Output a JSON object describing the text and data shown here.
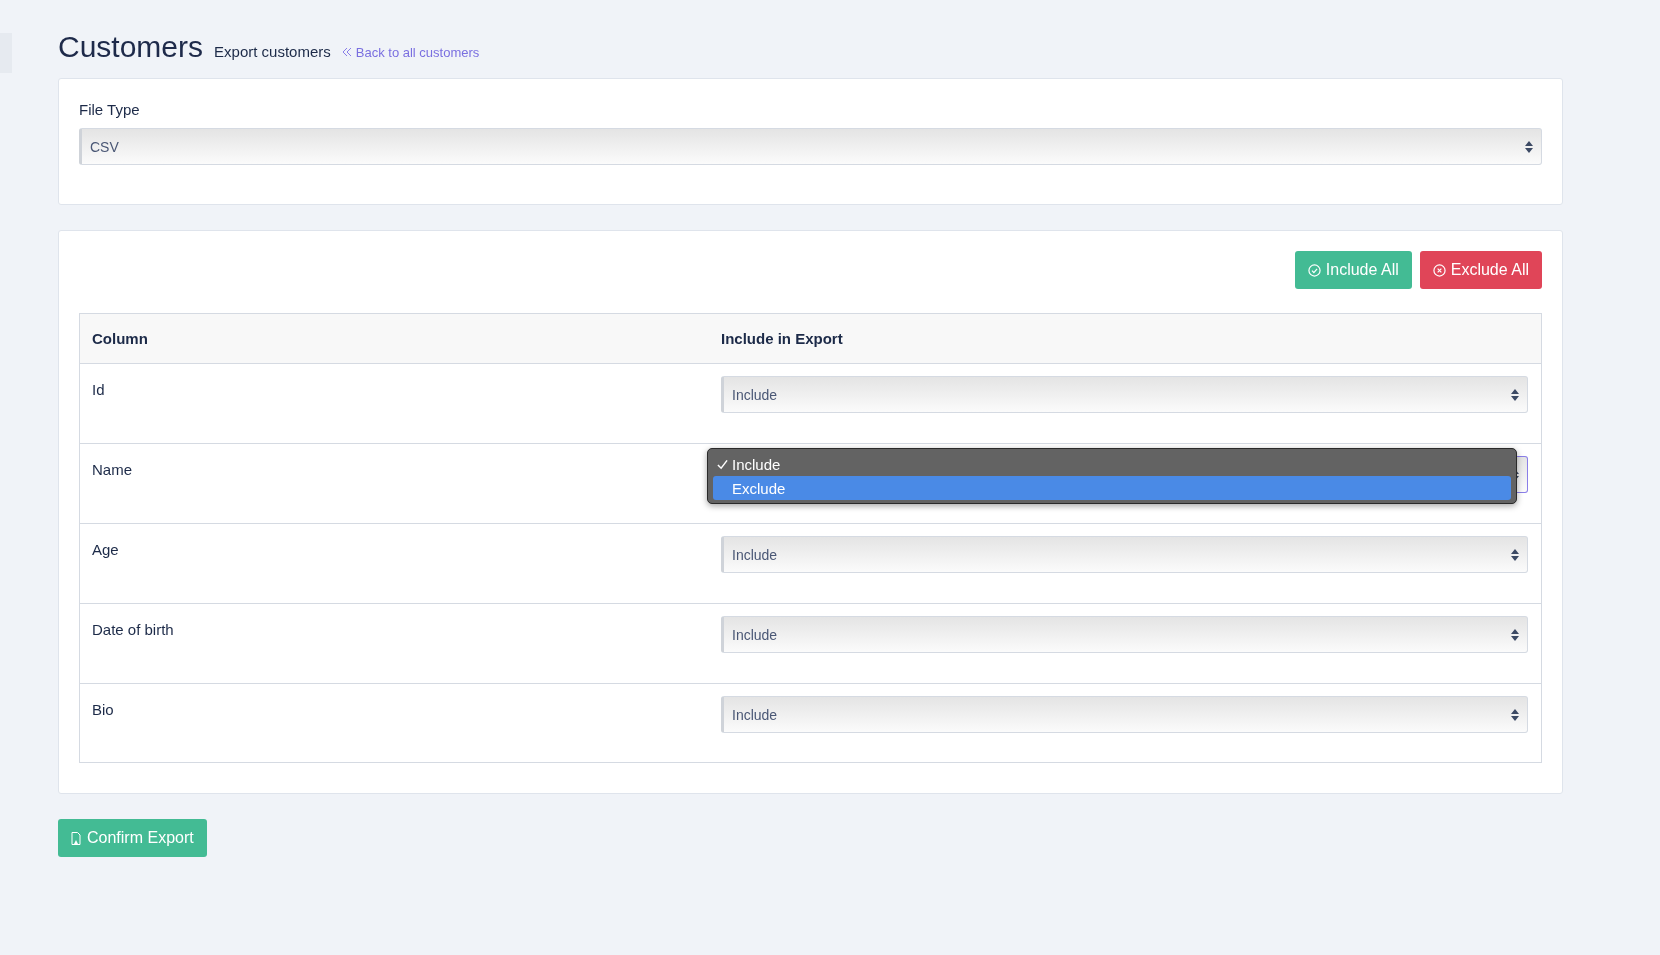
{
  "page": {
    "title": "Customers",
    "subtitle": "Export customers",
    "back_link": "Back to all customers"
  },
  "file_type": {
    "label": "File Type",
    "value": "CSV"
  },
  "actions": [
    {
      "label": "Include All",
      "kind": "include"
    },
    {
      "label": "Exclude All",
      "kind": "exclude"
    }
  ],
  "table": {
    "columns": [
      "Column",
      "Include in Export"
    ],
    "rows": [
      {
        "column": "Id",
        "value": "Include",
        "open": false
      },
      {
        "column": "Name",
        "open": true,
        "options": [
          {
            "label": "Include",
            "checked": true,
            "selected": false
          },
          {
            "label": "Exclude",
            "checked": false,
            "selected": true
          }
        ]
      },
      {
        "column": "Age",
        "value": "Include",
        "open": false
      },
      {
        "column": "Date of birth",
        "value": "Include",
        "open": false
      },
      {
        "column": "Bio",
        "value": "Include",
        "open": false
      }
    ]
  },
  "confirm_button": "Confirm Export"
}
